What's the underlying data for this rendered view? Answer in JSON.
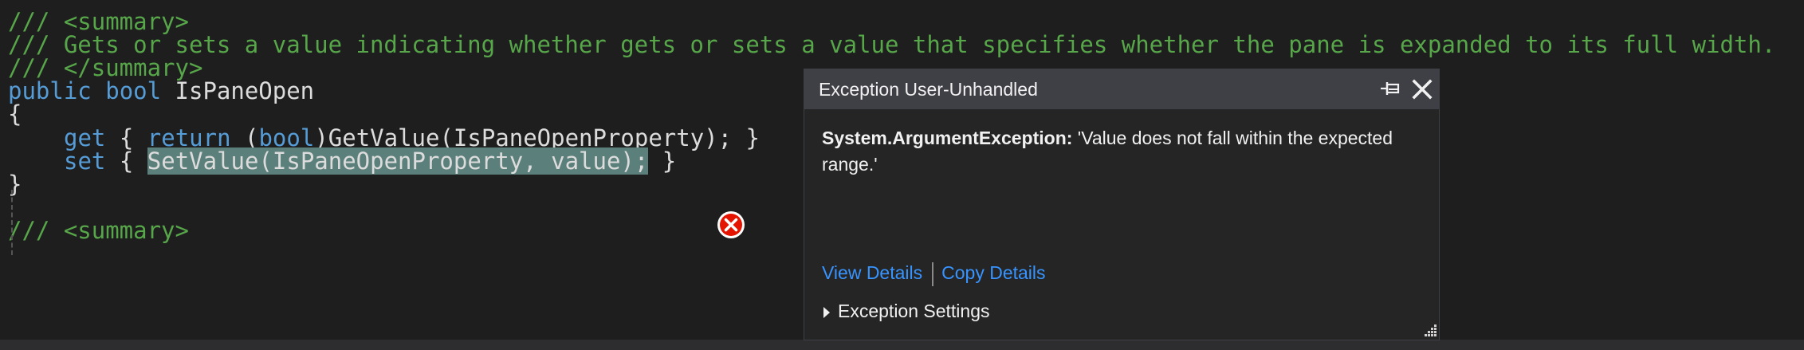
{
  "editor": {
    "lines": {
      "l1": "/// <summary>",
      "l2": "/// Gets or sets a value indicating whether gets or sets a value that specifies whether the pane is expanded to its full width.",
      "l3": "/// </summary>",
      "l4_kw1": "public",
      "l4_kw2": "bool",
      "l4_name": "IsPaneOpen",
      "l5": "{",
      "l6_get": "get",
      "l6_brace": " { ",
      "l6_return": "return",
      "l6_paren": " (",
      "l6_bool": "bool",
      "l6_rest": ")GetValue(IsPaneOpenProperty); }",
      "l7_set": "set",
      "l7_brace": " { ",
      "l7_stmt": "SetValue(IsPaneOpenProperty, value);",
      "l7_close": " }",
      "l8": "}",
      "l10": "/// <summary>"
    },
    "colors": {
      "comment": "#57a64a",
      "keyword": "#569cd6",
      "text": "#dcdcdc",
      "highlight": "#5b7f7a",
      "error": "#e51400"
    }
  },
  "popup": {
    "title": "Exception User-Unhandled",
    "exception_type": "System.ArgumentException:",
    "exception_message": " 'Value does not fall within the expected range.'",
    "view_details": "View Details",
    "copy_details": "Copy Details",
    "exception_settings": "Exception Settings",
    "icons": {
      "pin": "pin-icon",
      "close": "close-icon",
      "error": "error-icon",
      "resize": "resize-grip-icon"
    }
  }
}
